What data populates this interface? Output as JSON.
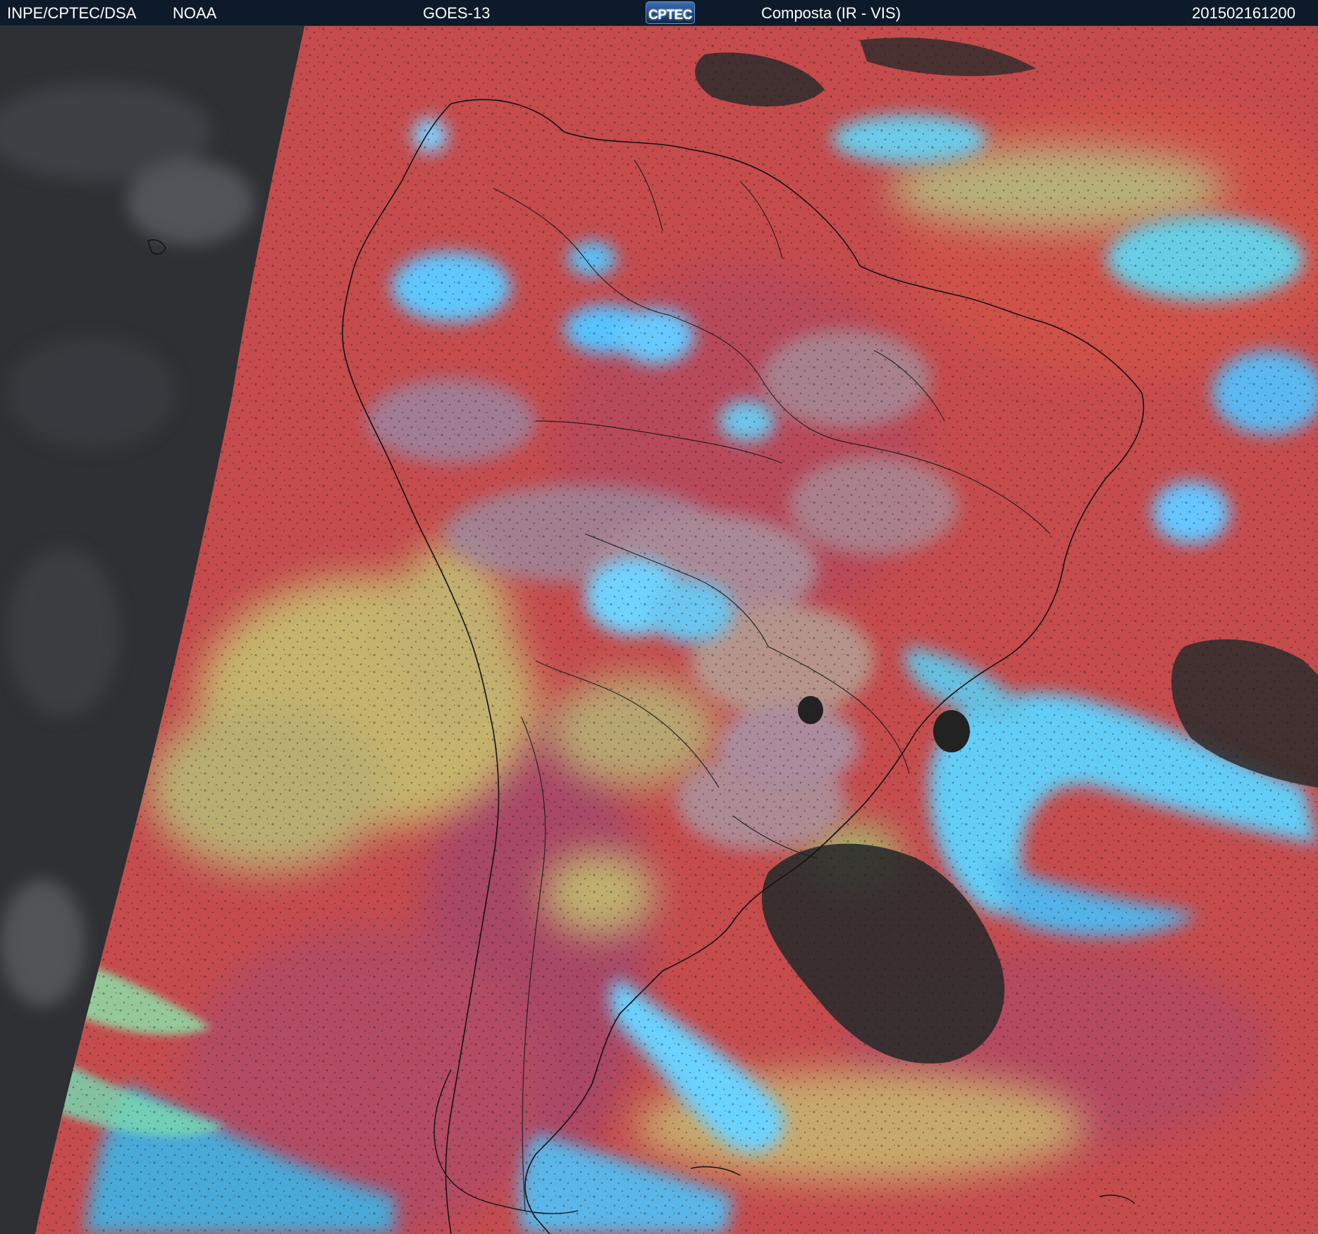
{
  "header": {
    "org": "INPE/CPTEC/DSA",
    "agency": "NOAA",
    "satellite": "GOES-13",
    "logo_text": "CPTEC",
    "product": "Composta (IR - VIS)",
    "timestamp": "201502161200"
  },
  "colors": {
    "header_bg": "#0d1a29",
    "night_side": "#2d2f33",
    "clear_surface": "#c84a4a",
    "low_cloud": "#b8b06a",
    "high_cloud": "#55c8ff",
    "coast_lines": "#111111"
  },
  "icons": [
    "cptec-logo-icon"
  ]
}
